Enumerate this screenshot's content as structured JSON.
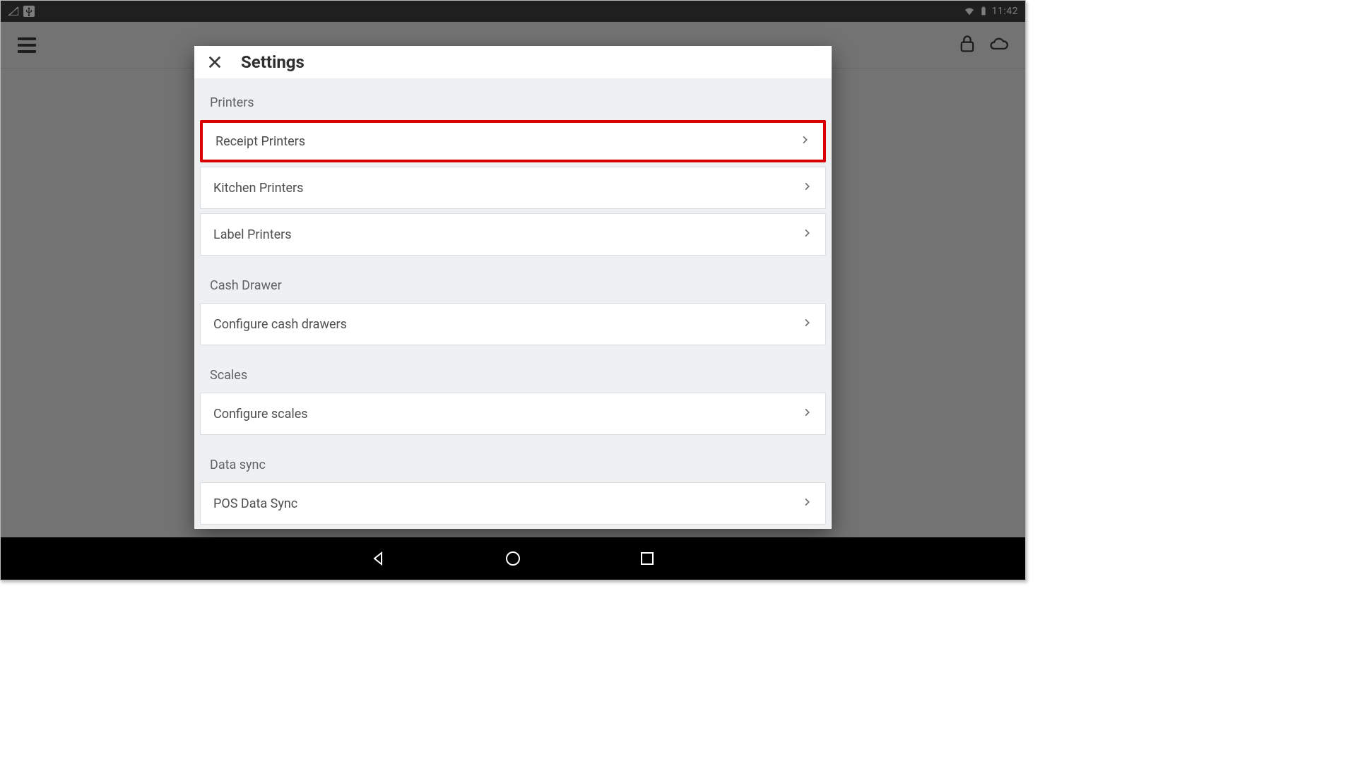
{
  "statusbar": {
    "clock": "11:42"
  },
  "toolbar": {},
  "modal": {
    "title": "Settings",
    "sections": [
      {
        "header": "Printers",
        "items": [
          {
            "label": "Receipt Printers",
            "highlight": true
          },
          {
            "label": "Kitchen Printers",
            "highlight": false
          },
          {
            "label": "Label Printers",
            "highlight": false
          }
        ]
      },
      {
        "header": "Cash Drawer",
        "items": [
          {
            "label": "Configure cash drawers",
            "highlight": false
          }
        ]
      },
      {
        "header": "Scales",
        "items": [
          {
            "label": "Configure scales",
            "highlight": false
          }
        ]
      },
      {
        "header": "Data sync",
        "items": [
          {
            "label": "POS Data Sync",
            "highlight": false
          }
        ]
      }
    ]
  }
}
